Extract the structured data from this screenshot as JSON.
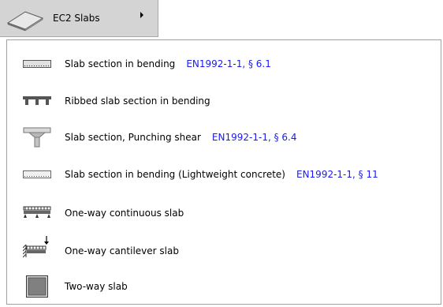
{
  "menu": {
    "trigger_label": "EC2 Slabs",
    "items": [
      {
        "label": "Slab section in bending",
        "ref": "EN1992-1-1, § 6.1",
        "icon": "slab-section-icon"
      },
      {
        "label": "Ribbed slab section in bending",
        "ref": "",
        "icon": "ribbed-slab-icon"
      },
      {
        "label": "Slab section, Punching shear",
        "ref": "EN1992-1-1, § 6.4",
        "icon": "punching-shear-icon"
      },
      {
        "label": "Slab section in bending (Lightweight concrete)",
        "ref": "EN1992-1-1, § 11",
        "icon": "lightweight-slab-icon"
      },
      {
        "label": "One-way continuous slab",
        "ref": "",
        "icon": "continuous-slab-icon"
      },
      {
        "label": "One-way cantilever slab",
        "ref": "",
        "icon": "cantilever-slab-icon"
      },
      {
        "label": "Two-way slab",
        "ref": "",
        "icon": "two-way-slab-icon"
      }
    ]
  },
  "colors": {
    "trigger_bg": "#d4d4d4",
    "reference_link": "#1a1af0"
  }
}
